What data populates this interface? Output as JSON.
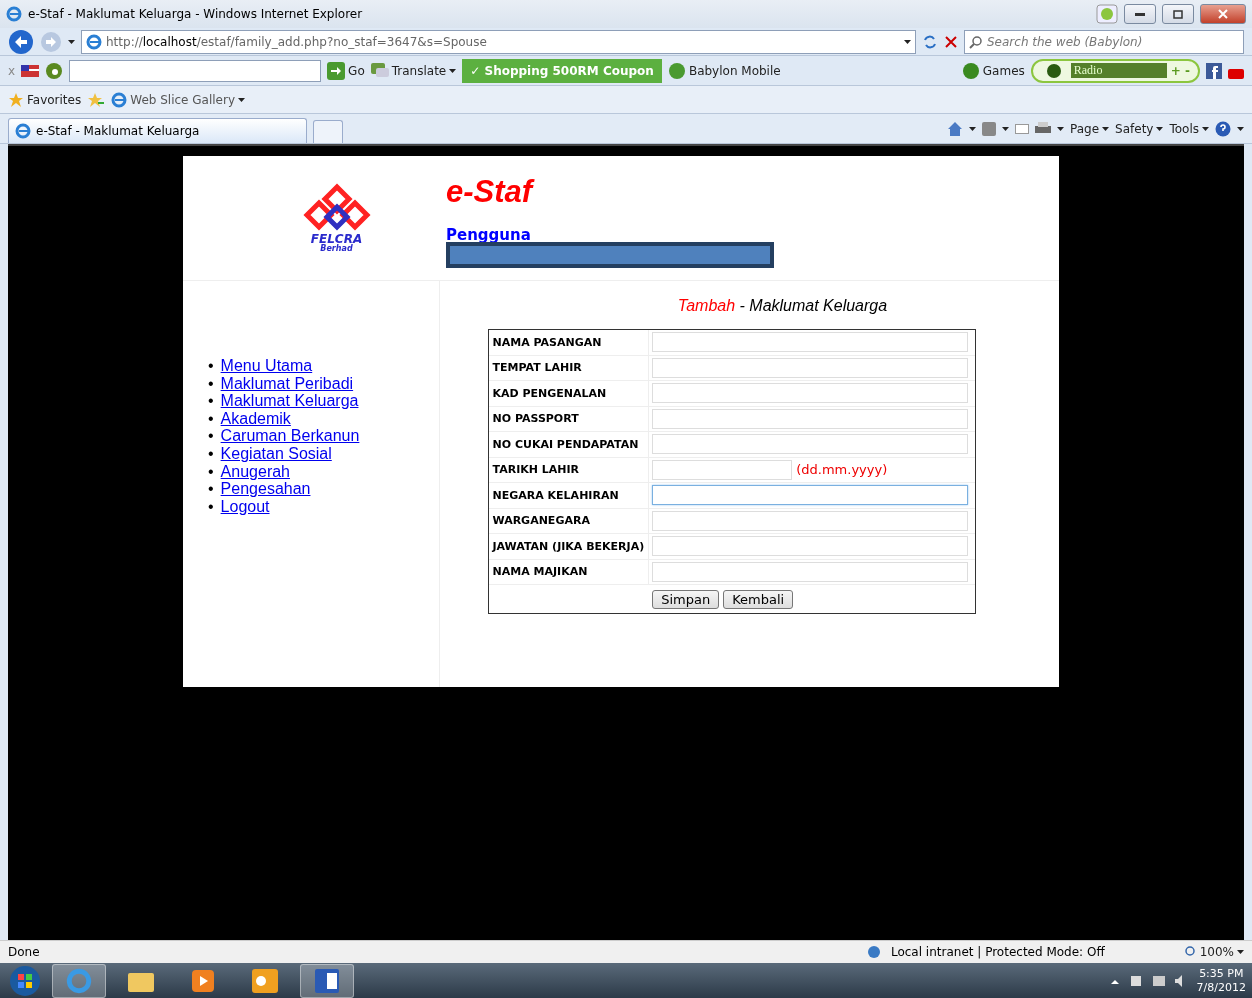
{
  "window": {
    "title": "e-Staf - Maklumat Keluarga - Windows Internet Explorer"
  },
  "address_bar": {
    "prefix": "http://",
    "host": "localhost",
    "path": "/estaf/family_add.php?no_staf=3647&s=Spouse"
  },
  "search": {
    "placeholder": "Search the web (Babylon)"
  },
  "toolbar": {
    "close": "x",
    "go": "Go",
    "translate": "Translate",
    "coupon": "✓ Shopping 500RM Coupon",
    "mobile": "Babylon Mobile",
    "games": "Games",
    "radio": "Radio",
    "radio_controls": "+ -"
  },
  "favorites_bar": {
    "favorites": "Favorites",
    "web_slice": "Web Slice Gallery"
  },
  "tabs": [
    {
      "label": "e-Staf - Maklumat Keluarga",
      "selected": true
    }
  ],
  "command_bar": [
    "Page",
    "Safety",
    "Tools"
  ],
  "page": {
    "logo": {
      "name": "FELCRA",
      "sub": "Berhad"
    },
    "app_title": "e-Staf",
    "user_label": "Pengguna",
    "nav": [
      {
        "bullet": "•",
        "label": "Menu Utama"
      },
      {
        "bullet": "•",
        "label": "Maklumat Peribadi"
      },
      {
        "bullet": "•",
        "label": "Maklumat Keluarga"
      },
      {
        "bullet": "•",
        "label": "Akademik"
      },
      {
        "bullet": "•",
        "label": "Caruman Berkanun"
      },
      {
        "bullet": "•",
        "label": "Kegiatan Sosial"
      },
      {
        "bullet": "•",
        "label": "Anugerah"
      },
      {
        "bullet": "•",
        "label": "Pengesahan"
      },
      {
        "bullet": "•",
        "label": "Logout"
      }
    ],
    "form_title": {
      "action": "Tambah",
      "rest": " - Maklumat Keluarga"
    },
    "fields": [
      {
        "label": "NAMA PASANGAN",
        "focused": false
      },
      {
        "label": "TEMPAT LAHIR",
        "focused": false
      },
      {
        "label": "KAD PENGENALAN",
        "focused": false
      },
      {
        "label": "NO PASSPORT",
        "focused": false
      },
      {
        "label": "NO CUKAI PENDAPATAN",
        "focused": false
      },
      {
        "label": "TARIKH LAHIR",
        "focused": false,
        "hint": "(dd.mm.yyyy)"
      },
      {
        "label": "NEGARA KELAHIRAN",
        "focused": true
      },
      {
        "label": "WARGANEGARA",
        "focused": false
      },
      {
        "label": "JAWATAN (JIKA BEKERJA)",
        "focused": false
      },
      {
        "label": "NAMA MAJIKAN",
        "focused": false
      }
    ],
    "buttons": [
      "Simpan",
      "Kembali"
    ]
  },
  "status_bar": {
    "text": "Done",
    "zone": "Local intranet | Protected Mode: Off",
    "zoom": "100%"
  },
  "taskbar": {
    "time": "5:35 PM",
    "date": "7/8/2012"
  }
}
